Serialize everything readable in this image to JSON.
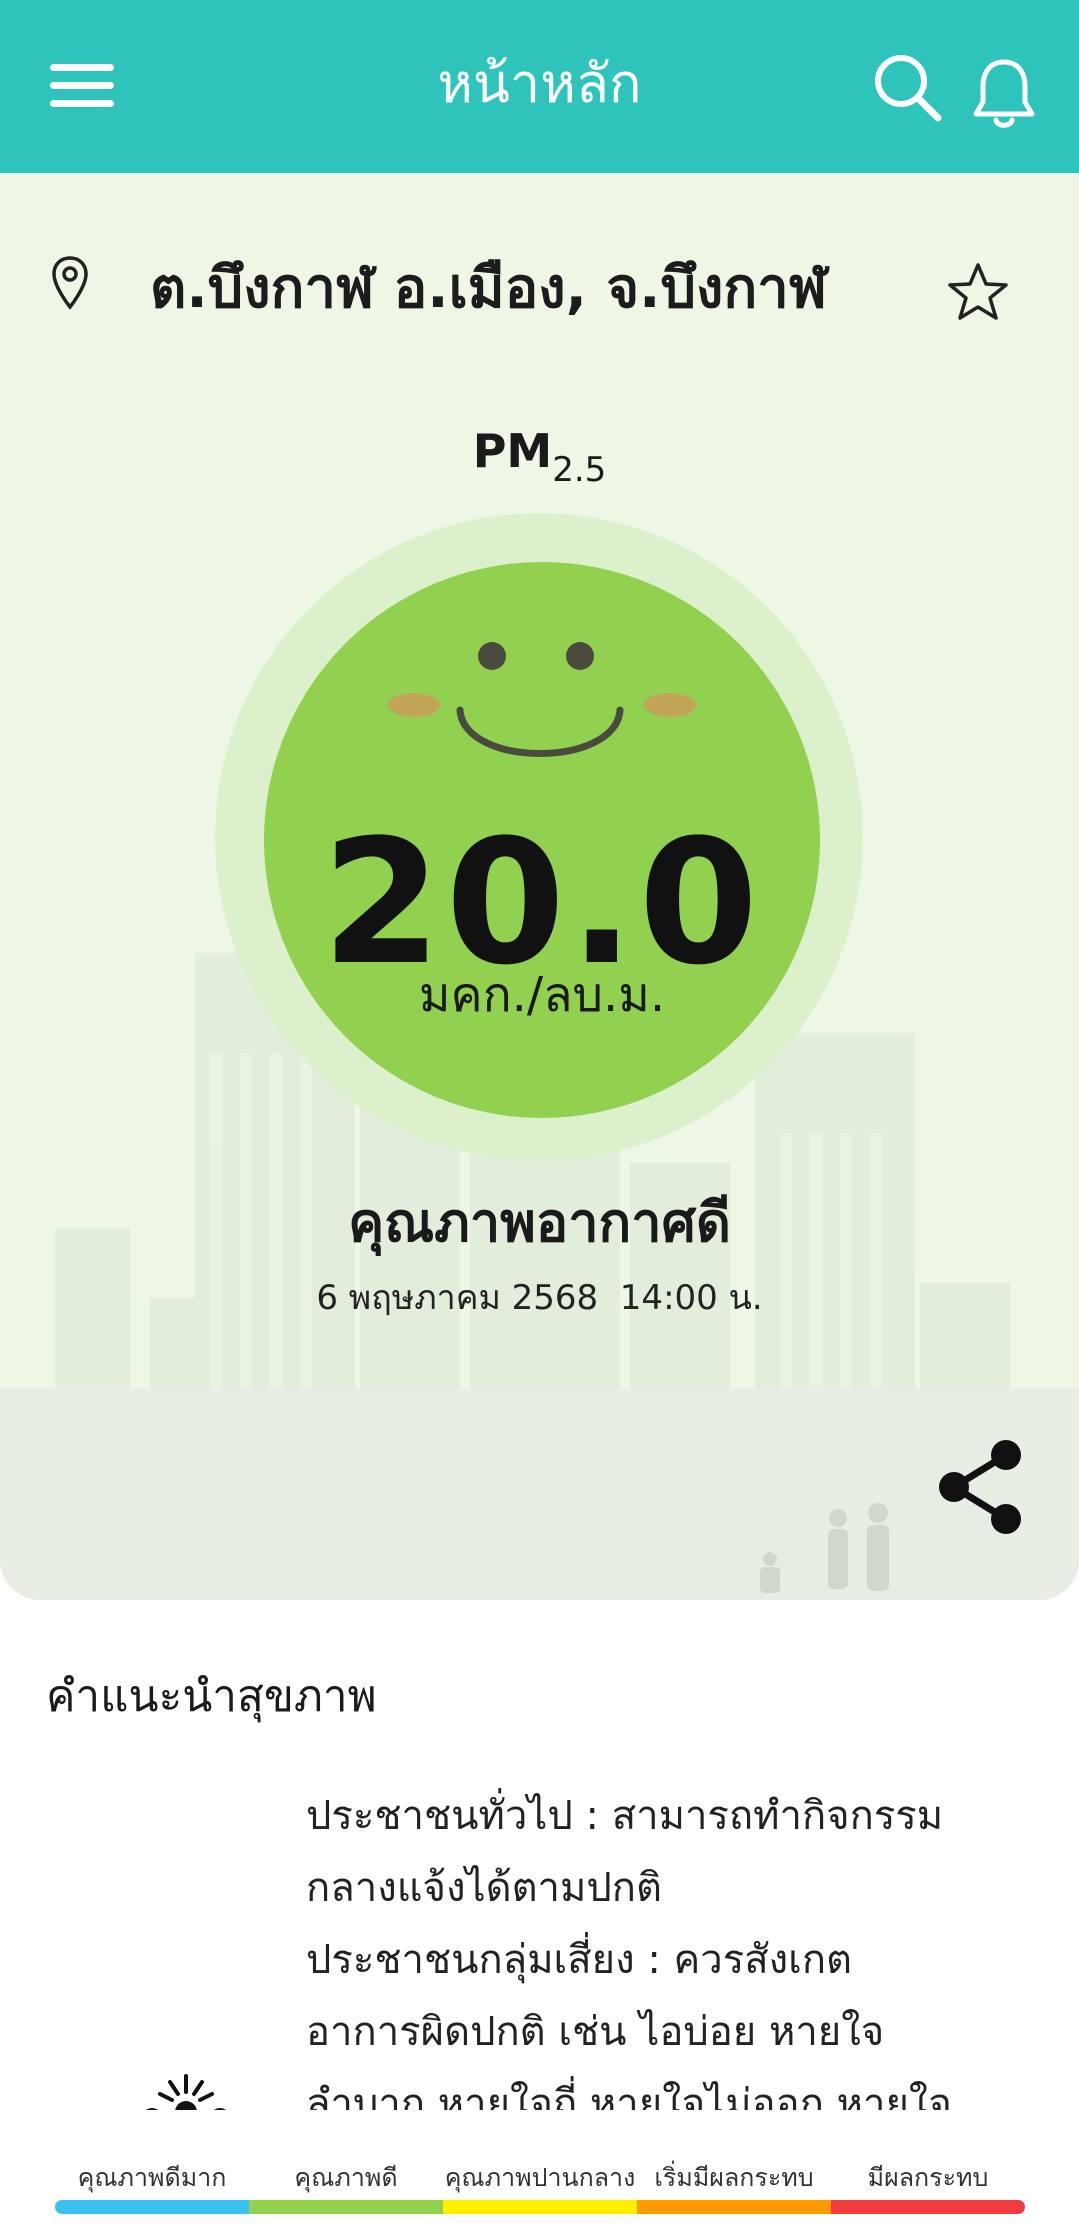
{
  "header": {
    "title": "หน้าหลัก",
    "menu_icon": "hamburger-menu-icon",
    "search_icon": "search-icon",
    "notification_icon": "bell-icon",
    "background_color": "#2ec4bc"
  },
  "location": {
    "name": "ต.บึงกาฬ อ.เมือง, จ.บึงกาฬ",
    "pin_icon": "location-pin-icon",
    "favorite_icon": "star-outline-icon"
  },
  "pm": {
    "label": "PM",
    "subscript": "2.5",
    "value": "20.0",
    "unit": "มคก./ลบ.ม.",
    "quality": "คุณภาพอากาศดี",
    "timestamp": "6 พฤษภาคม 2568  14:00 น.",
    "gauge_color": "#92d050",
    "face_icon": "smiley-face-icon"
  },
  "share": {
    "icon": "share-icon"
  },
  "health_advice": {
    "title": "คำแนะนำสุขภาพ",
    "lines": [
      "ประชาชนทั่วไป : สามารถทำกิจกรรม",
      "กลางแจ้งได้ตามปกติ",
      "ประชาชนกลุ่มเสี่ยง : ควรสังเกต",
      "อาการผิดปกติ เช่น ไอบ่อย หายใจ",
      "ลำบาก หายใจถี่ หายใจไม่ออก หายใจ"
    ]
  },
  "legend": [
    {
      "label": "คุณภาพดีมาก",
      "color": "#3bc1f0"
    },
    {
      "label": "คุณภาพดี",
      "color": "#92d050"
    },
    {
      "label": "คุณภาพปานกลาง",
      "color": "#ffee00"
    },
    {
      "label": "เริ่มมีผลกระทบ",
      "color": "#ff9a00"
    },
    {
      "label": "มีผลกระทบ",
      "color": "#f03c3c"
    }
  ]
}
